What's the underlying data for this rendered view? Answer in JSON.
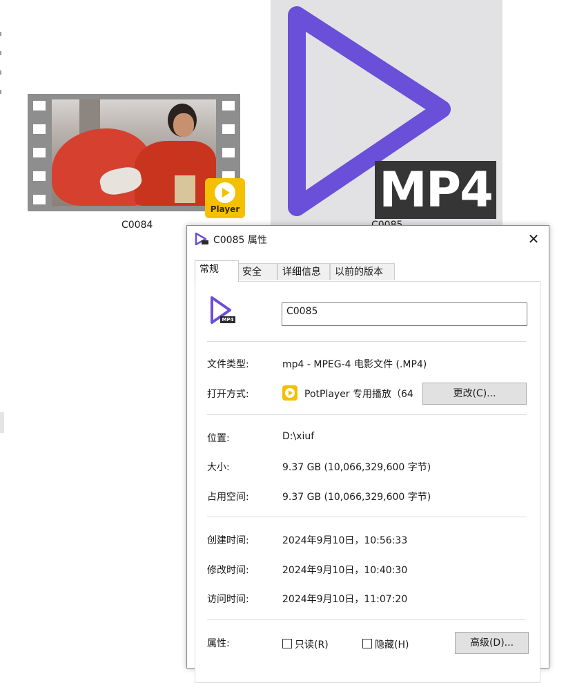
{
  "desktop": {
    "items": [
      {
        "caption": "C0084",
        "badge_text": "Player",
        "kind": "video-thumbnail"
      },
      {
        "caption": "C0085",
        "badge_text": "MP4",
        "kind": "potplayer-mp4-icon"
      }
    ]
  },
  "dialog": {
    "title": "C0085 属性",
    "close_glyph": "✕",
    "tabs": [
      {
        "label": "常规",
        "active": true
      },
      {
        "label": "安全",
        "active": false
      },
      {
        "label": "详细信息",
        "active": false
      },
      {
        "label": "以前的版本",
        "active": false
      }
    ],
    "file_name": "C0085",
    "file_icon_badge": "MP4",
    "file_type": {
      "label": "文件类型:",
      "value": "mp4 - MPEG-4 电影文件 (.MP4)"
    },
    "opens_with": {
      "label": "打开方式:",
      "value": "PotPlayer 专用播放（64",
      "change_button": "更改(C)..."
    },
    "location": {
      "label": "位置:",
      "value": "D:\\xiuf"
    },
    "size": {
      "label": "大小:",
      "value": "9.37 GB (10,066,329,600 字节)"
    },
    "size_on_disk": {
      "label": "占用空间:",
      "value": "9.37 GB (10,066,329,600 字节)"
    },
    "created": {
      "label": "创建时间:",
      "value": "2024年9月10日，10:56:33"
    },
    "modified": {
      "label": "修改时间:",
      "value": "2024年9月10日，10:40:30"
    },
    "accessed": {
      "label": "访问时间:",
      "value": "2024年9月10日，11:07:20"
    },
    "attributes": {
      "label": "属性:",
      "readonly_label": "只读(R)",
      "readonly_checked": false,
      "hidden_label": "隐藏(H)",
      "hidden_checked": false,
      "advanced_button": "高级(D)..."
    }
  },
  "colors": {
    "potplayer_purple": "#6a4fd8",
    "potplayer_yellow": "#f4c000",
    "film_gray": "#8e8e8e"
  }
}
